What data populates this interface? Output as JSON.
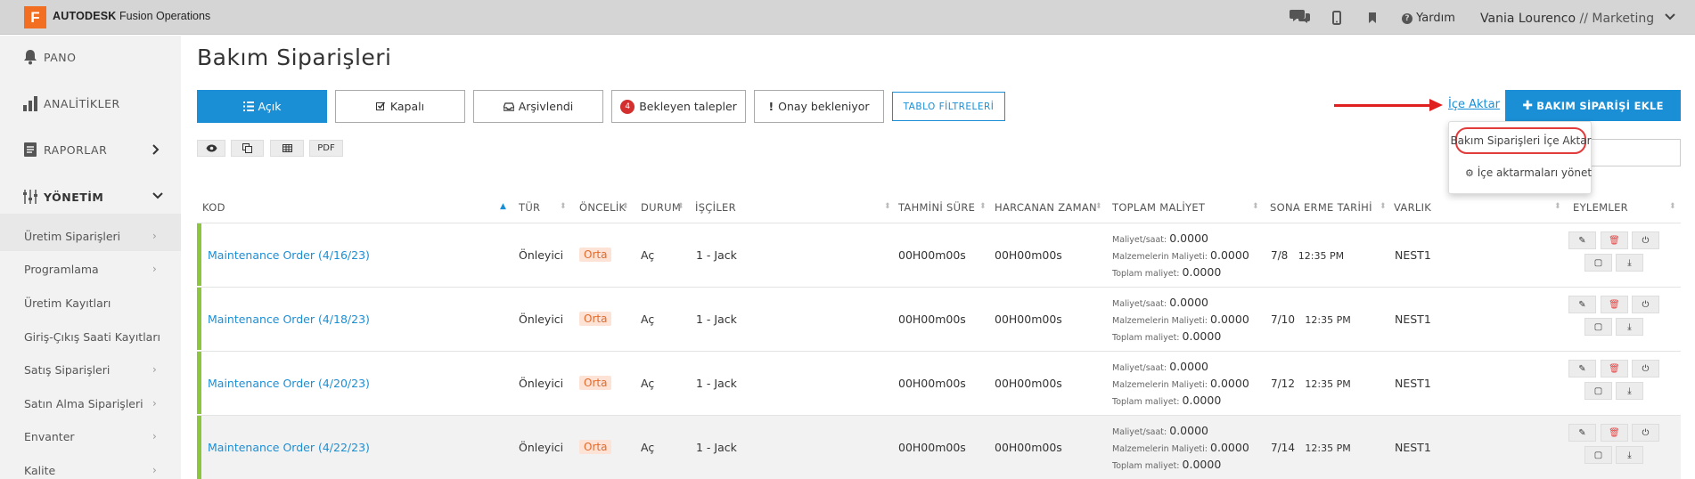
{
  "topbar": {
    "logo_letter": "F",
    "brand_bold": "AUTODESK",
    "brand_rest": " Fusion Operations",
    "help": "Yardım",
    "user_name": "Vania Lourenco",
    "user_role": " // Marketing"
  },
  "sidebar": {
    "main": [
      {
        "label": "PANO",
        "icon": "bell-icon"
      },
      {
        "label": "ANALİTİKLER",
        "icon": "bar-chart-icon"
      },
      {
        "label": "RAPORLAR",
        "icon": "report-icon"
      },
      {
        "label": "YÖNETİM",
        "icon": "sliders-icon"
      }
    ],
    "sub": [
      "Üretim Siparişleri",
      "Programlama",
      "Üretim Kayıtları",
      "Giriş-Çıkış Saati Kayıtları",
      "Satış Siparişleri",
      "Satın Alma Siparişleri",
      "Envanter",
      "Kalite"
    ]
  },
  "page": {
    "title": "Bakım Siparişleri"
  },
  "tabs": {
    "open": "Açık",
    "closed": "Kapalı",
    "archived": "Arşivlendi",
    "pending_count": "4",
    "pending": "Bekleyen talepler",
    "awaiting": "Onay bekleniyor",
    "filters": "TABLO FİLTRELERİ"
  },
  "tools": {
    "pdf": "PDF"
  },
  "actions": {
    "import": "İçe Aktar",
    "add": "BAKIM SİPARİŞİ EKLE",
    "import_orders": "Bakım Siparişleri İçe Aktar",
    "manage_imports": "İçe aktarmaları yönet"
  },
  "table": {
    "headers": [
      "KOD",
      "TÜR",
      "ÖNCELİK",
      "DURUM",
      "İŞÇİLER",
      "TAHMİNİ SÜRE",
      "HARCANAN ZAMAN",
      "TOPLAM MALİYET",
      "SONA ERME TARİHİ",
      "VARLIK",
      "EYLEMLER"
    ],
    "cost_labels": {
      "hour": "Maliyet/saat:",
      "material": "Malzemelerin Maliyeti:",
      "total": "Toplam maliyet:"
    },
    "rows": [
      {
        "code": "Maintenance Order (4/16/23)",
        "type": "Önleyici",
        "priority": "Orta",
        "status": "Aç",
        "workers": "1 - Jack",
        "est": "00H00m00s",
        "spent": "00H00m00s",
        "cost_hour": "0.0000",
        "cost_material": "0.0000",
        "cost_total": "0.0000",
        "due_date": "7/8",
        "due_time": "12:35 PM",
        "asset": "NEST1"
      },
      {
        "code": "Maintenance Order (4/18/23)",
        "type": "Önleyici",
        "priority": "Orta",
        "status": "Aç",
        "workers": "1 - Jack",
        "est": "00H00m00s",
        "spent": "00H00m00s",
        "cost_hour": "0.0000",
        "cost_material": "0.0000",
        "cost_total": "0.0000",
        "due_date": "7/10",
        "due_time": "12:35 PM",
        "asset": "NEST1"
      },
      {
        "code": "Maintenance Order (4/20/23)",
        "type": "Önleyici",
        "priority": "Orta",
        "status": "Aç",
        "workers": "1 - Jack",
        "est": "00H00m00s",
        "spent": "00H00m00s",
        "cost_hour": "0.0000",
        "cost_material": "0.0000",
        "cost_total": "0.0000",
        "due_date": "7/12",
        "due_time": "12:35 PM",
        "asset": "NEST1"
      },
      {
        "code": "Maintenance Order (4/22/23)",
        "type": "Önleyici",
        "priority": "Orta",
        "status": "Aç",
        "workers": "1 - Jack",
        "est": "00H00m00s",
        "spent": "00H00m00s",
        "cost_hour": "0.0000",
        "cost_material": "0.0000",
        "cost_total": "0.0000",
        "due_date": "7/14",
        "due_time": "12:35 PM",
        "asset": "NEST1"
      }
    ]
  },
  "colors": {
    "accent": "#1a8fd6",
    "brand": "#f26f22",
    "row_bar": "#8cc63f",
    "highlight": "#e01f1f"
  }
}
